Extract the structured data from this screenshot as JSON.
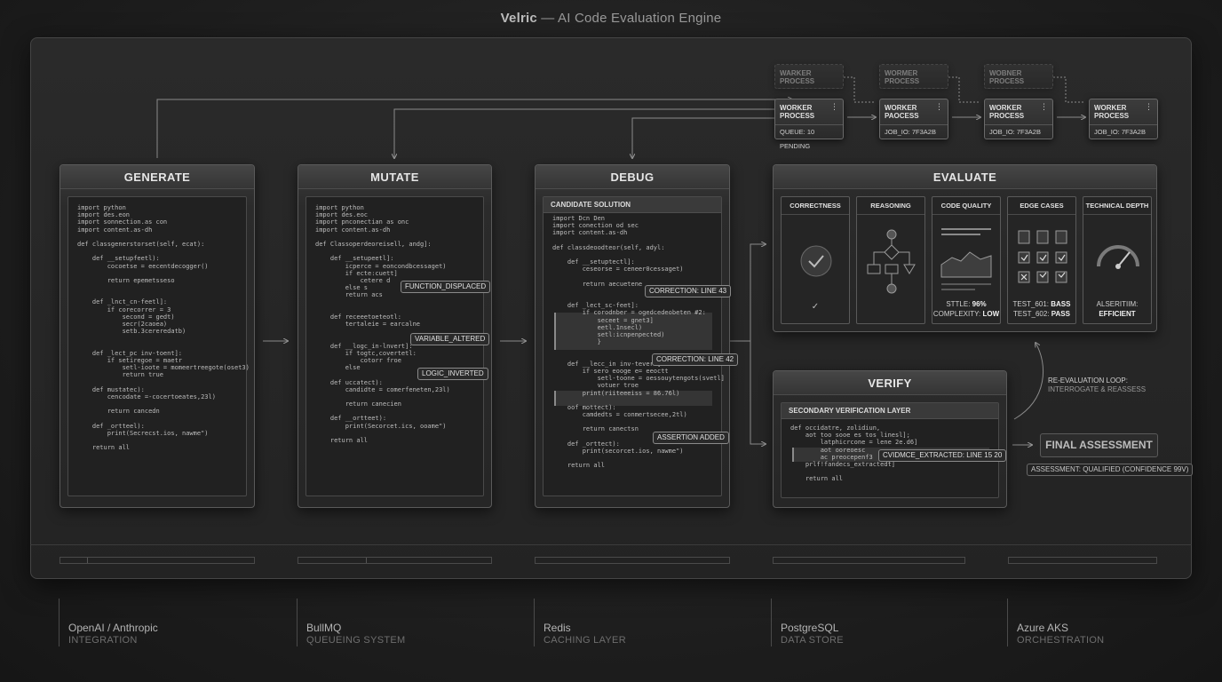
{
  "header": {
    "brand": "Velric",
    "separator": " — ",
    "subtitle": "AI Code Evaluation Engine"
  },
  "stages": {
    "generate": {
      "title": "GENERATE",
      "code": [
        "import python",
        "import des.eon",
        "import sonnection.as con",
        "import content.as-dh",
        "",
        "def classgenerstorset(self, ecat):",
        "",
        "    def __setupfeetl):",
        "        cocoetse = eecentdecogger()",
        "",
        "        return epemetsseso",
        "",
        "",
        "    def _lnct_cn-feetl]:",
        "        if corecorrer = 3",
        "            second = gedt)",
        "            secr(2caoea)",
        "            setb.3cereredatb)",
        "",
        "",
        "    def _lect_pc inv-toent]:",
        "        if setiregoe = maetr",
        "            setl-ioote = momeertreegote(oset3)",
        "            return true",
        "",
        "    def mustatec):",
        "        cencodate =-cocertoeates,23l)",
        "",
        "        return cancedn",
        "",
        "    def _ortteel):",
        "        print(Secrecst.ios, nawme\")",
        "",
        "    return all"
      ]
    },
    "mutate": {
      "title": "MUTATE",
      "code": [
        "import python",
        "import des.eoc",
        "import pnconectian as onc",
        "import content.as-dh",
        "",
        "def Classoperdeoreisell, andg]:",
        "",
        "    def __setupeetl]:",
        "        icperce = eoncondbcessaget)",
        "        if ecte:cuett]",
        "            cetere d",
        "        else s",
        "        return acs",
        "",
        "",
        "    def receeetoeteotl:",
        "        tertaleie = earcalne",
        "",
        "",
        "    def __logc_in-lnvert]:",
        "        if togtc,covertetl:",
        "            cotorr froe",
        "        else",
        "",
        "    def uccatect):",
        "        candidte = comerfeneten,23l)",
        "",
        "        return canecien",
        "",
        "    def __ortteet):",
        "        print(Secorcet.ics, ooame\")",
        "",
        "    return all"
      ],
      "tags": [
        "FUNCTION_DISPLACED",
        "VARIABLE_ALTERED",
        "LOGIC_INVERTED"
      ]
    },
    "debug": {
      "title": "DEBUG",
      "panel_title": "CANDIDATE SOLUTION",
      "code": [
        "import Dcn Den",
        "import conection od sec",
        "import content.as-dh",
        "",
        "def classdeoodteor(self, adyl:",
        "",
        "    def __setuptectl]:",
        "        ceseorse = ceneer0cessaget)",
        "",
        "        return aecuetene",
        "",
        "",
        "    def _lect_sc-feet]:",
        "        if corodnber = ogedcedeobeten #2:",
        "            seceet = gnet3]",
        "            eetl.1nsecl)",
        "            setl:icnpenpected)",
        "            }",
        "",
        "",
        "    def __lecc_in inv-tevert]:",
        "        if sero eooge e= eeoctt",
        "            setl-toone = oessouytengots(svetl]",
        "            votuer troe",
        "        print(riiteeeiss = 86.76l)",
        "",
        "    oof mottect):",
        "        camdedts = conmertsecee,2tl)",
        "",
        "        return canectsn",
        "",
        "    def _orttect):",
        "        print(secorcet.ios, nawme\")",
        "",
        "    return all"
      ],
      "tags": [
        "CORRECTION: LINE 43",
        "CORRECTION: LINE 42",
        "ASSERTION ADDED"
      ]
    },
    "evaluate": {
      "title": "EVALUATE",
      "cards": [
        {
          "label": "CORRECTNESS"
        },
        {
          "label": "REASONING"
        },
        {
          "label": "CODE QUALITY",
          "line1_prefix": "STTLE: ",
          "line1_value": "96%",
          "line2_prefix": "COMPLEXITY: ",
          "line2_value": "LOW"
        },
        {
          "label": "EDGE CASES",
          "line1_prefix": "TEST_601: ",
          "line1_value": "BASS",
          "line2_prefix": "TEST_602: ",
          "line2_value": "PASS"
        },
        {
          "label": "TECHNICAL DEPTH",
          "line1_prefix": "ALSERITIIM:",
          "line1_value": "",
          "line2_prefix": "",
          "line2_value": "EFFICIENT"
        }
      ]
    },
    "verify": {
      "title": "VERIFY",
      "panel_title": "SECONDARY VERIFICATION LAYER",
      "code": [
        "def occidatre, zolidiun,",
        "    aot too sooe es tos linesl];",
        "        latphicrcone = lene 2e.d6]",
        "        aot ooreoesc",
        "        ac preocepenf3",
        "    prlf!fandecs_extractedt]",
        "",
        "    return all"
      ],
      "tag": "CVIDMCE_EXTRACTED: LINE 15 20"
    }
  },
  "workers": [
    {
      "title_l1": "WORKER",
      "title_l2": "PROCESS",
      "footer": "QUEUE: 10 PENDING"
    },
    {
      "title_l1": "WORKER",
      "title_l2": "PAOCESS",
      "footer": "JOB_IO: 7F3A2B"
    },
    {
      "title_l1": "WORKER",
      "title_l2": "PROCESS",
      "footer": "JOB_IO: 7F3A2B"
    },
    {
      "title_l1": "WORKER",
      "title_l2": "PROCESS",
      "footer": "JOB_IO: 7F3A2B"
    }
  ],
  "ghost_workers": [
    {
      "title_l1": "WARKER",
      "title_l2": "PROCESS"
    },
    {
      "title_l1": "WORMER",
      "title_l2": "PROCESS"
    },
    {
      "title_l1": "WOBNER",
      "title_l2": "PROCESS"
    }
  ],
  "loop": {
    "label": "RE-EVALUATION LOOP:",
    "sub": "INTERROGATE & REASSESS"
  },
  "final": {
    "label": "FINAL ASSESSMENT",
    "sub": "ASSESSMENT: QUALIFIED (CONFIDENCE 99V)"
  },
  "tech_stack": [
    {
      "name": "OpenAI / Anthropic",
      "role": "INTEGRATION"
    },
    {
      "name": "BullMQ",
      "role": "QUEUEING SYSTEM"
    },
    {
      "name": "Redis",
      "role": "CACHING LAYER"
    },
    {
      "name": "PostgreSQL",
      "role": "DATA STORE"
    },
    {
      "name": "Azure AKS",
      "role": "ORCHESTRATION"
    }
  ],
  "colors": {
    "background": "#1e1e1e",
    "panel": "#262626",
    "border": "#5a5a5a",
    "text": "#d8d8d8"
  }
}
